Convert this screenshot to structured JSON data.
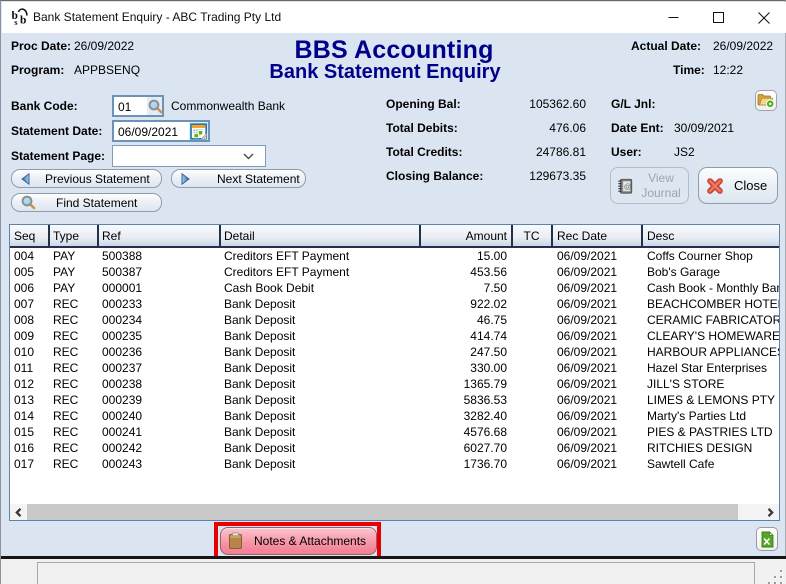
{
  "window": {
    "title": "Bank Statement Enquiry - ABC Trading Pty Ltd"
  },
  "header": {
    "proc_date_label": "Proc Date:",
    "proc_date": "26/09/2022",
    "program_label": "Program:",
    "program": "APPBSENQ",
    "app_title": "BBS Accounting",
    "screen_title": "Bank Statement Enquiry",
    "actual_date_label": "Actual Date:",
    "actual_date": "26/09/2022",
    "time_label": "Time:",
    "time": "12:22"
  },
  "form": {
    "bank_code_label": "Bank Code:",
    "bank_code": "01",
    "bank_name": "Commonwealth Bank",
    "statement_date_label": "Statement Date:",
    "statement_date": "06/09/2021",
    "statement_page_label": "Statement Page:",
    "statement_page": ""
  },
  "totals": {
    "opening_bal_label": "Opening Bal:",
    "opening_bal": "105362.60",
    "total_debits_label": "Total Debits:",
    "total_debits": "476.06",
    "total_credits_label": "Total Credits:",
    "total_credits": "24786.81",
    "closing_balance_label": "Closing Balance:",
    "closing_balance": "129673.35"
  },
  "journal": {
    "gl_jnl_label": "G/L Jnl:",
    "date_ent_label": "Date Ent:",
    "date_ent": "30/09/2021",
    "user_label": "User:",
    "user": "JS2"
  },
  "buttons": {
    "previous": "Previous Statement",
    "next": "Next Statement",
    "find": "Find Statement",
    "view_journal_line1": "View",
    "view_journal_line2": "Journal",
    "close": "Close",
    "notes": "Notes & Attachments"
  },
  "table": {
    "columns": [
      "Seq",
      "Type",
      "Ref",
      "Detail",
      "Amount",
      "TC",
      "Rec Date",
      "Desc"
    ],
    "rows": [
      {
        "seq": "004",
        "type": "PAY",
        "ref": "500388",
        "detail": "Creditors EFT Payment",
        "amount": "15.00",
        "tc": "",
        "rec_date": "06/09/2021",
        "desc": "Coffs Courner Shop"
      },
      {
        "seq": "005",
        "type": "PAY",
        "ref": "500387",
        "detail": "Creditors EFT Payment",
        "amount": "453.56",
        "tc": "",
        "rec_date": "06/09/2021",
        "desc": "Bob's Garage"
      },
      {
        "seq": "006",
        "type": "PAY",
        "ref": "000001",
        "detail": "Cash Book Debit",
        "amount": "7.50",
        "tc": "",
        "rec_date": "06/09/2021",
        "desc": "Cash Book - Monthly Bank"
      },
      {
        "seq": "007",
        "type": "REC",
        "ref": "000233",
        "detail": "Bank Deposit",
        "amount": "922.02",
        "tc": "",
        "rec_date": "06/09/2021",
        "desc": "BEACHCOMBER HOTEL"
      },
      {
        "seq": "008",
        "type": "REC",
        "ref": "000234",
        "detail": "Bank Deposit",
        "amount": "46.75",
        "tc": "",
        "rec_date": "06/09/2021",
        "desc": "CERAMIC FABRICATORS"
      },
      {
        "seq": "009",
        "type": "REC",
        "ref": "000235",
        "detail": "Bank Deposit",
        "amount": "414.74",
        "tc": "",
        "rec_date": "06/09/2021",
        "desc": "CLEARY'S HOMEWARES"
      },
      {
        "seq": "010",
        "type": "REC",
        "ref": "000236",
        "detail": "Bank Deposit",
        "amount": "247.50",
        "tc": "",
        "rec_date": "06/09/2021",
        "desc": "HARBOUR APPLIANCES"
      },
      {
        "seq": "011",
        "type": "REC",
        "ref": "000237",
        "detail": "Bank Deposit",
        "amount": "330.00",
        "tc": "",
        "rec_date": "06/09/2021",
        "desc": "Hazel Star Enterprises"
      },
      {
        "seq": "012",
        "type": "REC",
        "ref": "000238",
        "detail": "Bank Deposit",
        "amount": "1365.79",
        "tc": "",
        "rec_date": "06/09/2021",
        "desc": "JILL'S STORE"
      },
      {
        "seq": "013",
        "type": "REC",
        "ref": "000239",
        "detail": "Bank Deposit",
        "amount": "5836.53",
        "tc": "",
        "rec_date": "06/09/2021",
        "desc": "LIMES & LEMONS PTY LTD"
      },
      {
        "seq": "014",
        "type": "REC",
        "ref": "000240",
        "detail": "Bank Deposit",
        "amount": "3282.40",
        "tc": "",
        "rec_date": "06/09/2021",
        "desc": "Marty's Parties Ltd"
      },
      {
        "seq": "015",
        "type": "REC",
        "ref": "000241",
        "detail": "Bank Deposit",
        "amount": "4576.68",
        "tc": "",
        "rec_date": "06/09/2021",
        "desc": "PIES & PASTRIES LTD"
      },
      {
        "seq": "016",
        "type": "REC",
        "ref": "000242",
        "detail": "Bank Deposit",
        "amount": "6027.70",
        "tc": "",
        "rec_date": "06/09/2021",
        "desc": "RITCHIES DESIGN"
      },
      {
        "seq": "017",
        "type": "REC",
        "ref": "000243",
        "detail": "Bank Deposit",
        "amount": "1736.70",
        "tc": "",
        "rec_date": "06/09/2021",
        "desc": "Sawtell Cafe"
      }
    ]
  },
  "colors": {
    "title_navy": "#00008b",
    "annotation_red": "#e60000",
    "notes_pink": "#f78da0"
  }
}
